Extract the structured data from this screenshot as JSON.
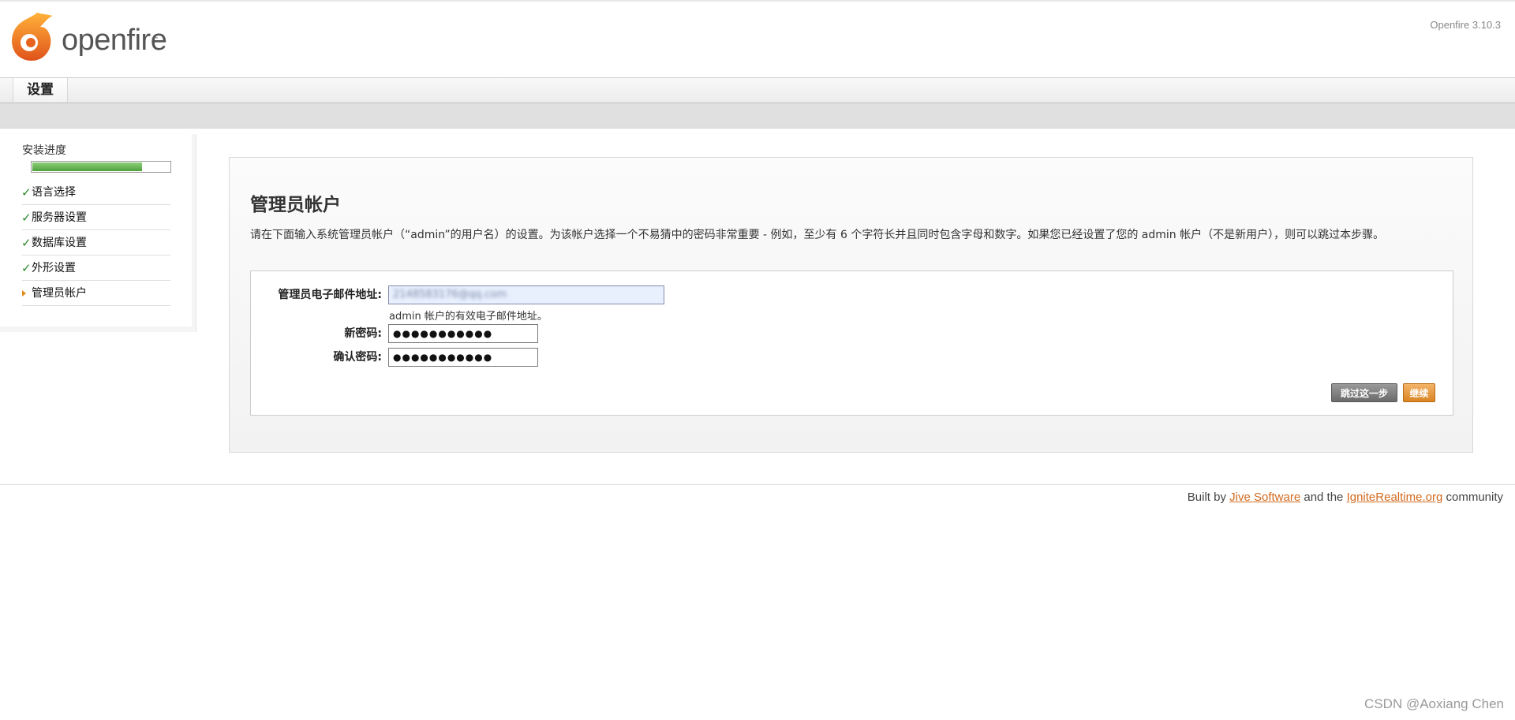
{
  "header": {
    "logo_text": "openfire",
    "logo_tm": "™",
    "version": "Openfire 3.10.3"
  },
  "tabs": [
    {
      "label": "设置"
    }
  ],
  "sidebar": {
    "progress_label": "安装进度",
    "progress_fraction": 0.8,
    "steps": [
      {
        "label": "语言选择",
        "status": "done",
        "icon": "checkmark-icon"
      },
      {
        "label": "服务器设置",
        "status": "done",
        "icon": "checkmark-icon"
      },
      {
        "label": "数据库设置",
        "status": "done",
        "icon": "checkmark-icon"
      },
      {
        "label": "外形设置",
        "status": "done",
        "icon": "checkmark-icon"
      },
      {
        "label": "管理员帐户",
        "status": "current",
        "icon": "triangle-right-icon"
      }
    ]
  },
  "main": {
    "title": "管理员帐户",
    "description": "请在下面输入系统管理员帐户（“admin”的用户名）的设置。为该帐户选择一个不易猜中的密码非常重要 - 例如，至少有 6 个字符长并且同时包含字母和数字。如果您已经设置了您的 admin 帐户（不是新用户），则可以跳过本步骤。",
    "form": {
      "email_label": "管理员电子邮件地址:",
      "email_value": "2148583176@qq.com",
      "email_hint": "admin 帐户的有效电子邮件地址。",
      "new_password_label": "新密码:",
      "new_password_value": "●●●●●●●●●●●",
      "confirm_password_label": "确认密码:",
      "confirm_password_value": "●●●●●●●●●●●"
    },
    "buttons": {
      "skip": "跳过这一步",
      "continue": "继续"
    }
  },
  "footer": {
    "prefix": "Built by ",
    "link1": "Jive Software",
    "middle": " and the ",
    "link2": "IgniteRealtime.org",
    "suffix": " community"
  },
  "watermark": "CSDN @Aoxiang Chen",
  "colors": {
    "accent": "#d98422",
    "progress": "#4ea13b",
    "check": "#2b8a2b",
    "link": "#d2691e"
  }
}
